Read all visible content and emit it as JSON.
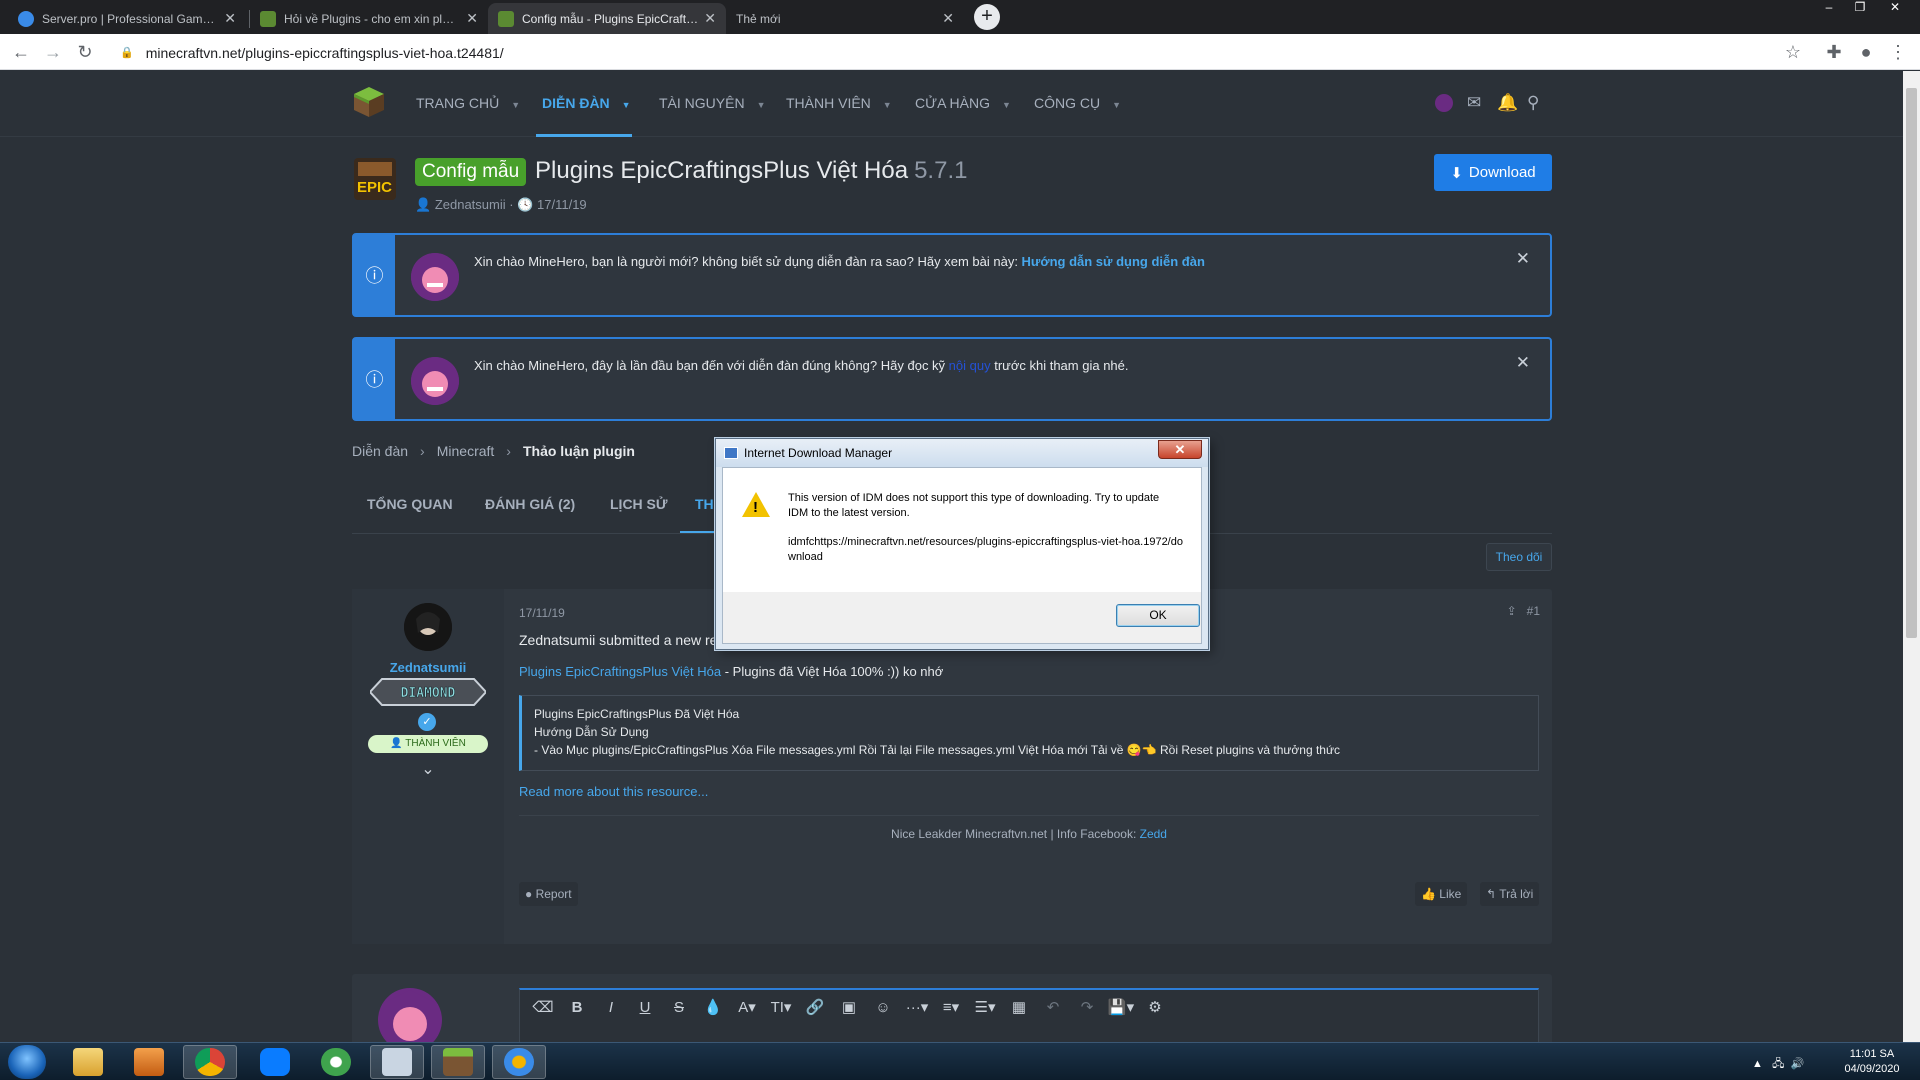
{
  "browser": {
    "tabs": [
      {
        "title": "Server.pro | Professional Game Se",
        "icon": "serverpro-icon",
        "active": false
      },
      {
        "title": "Hỏi về Plugins - cho em xin plugin",
        "icon": "minecraft-icon",
        "active": false
      },
      {
        "title": "Config mẫu - Plugins EpicCrafting",
        "icon": "minecraft-icon",
        "active": true
      },
      {
        "title": "Thẻ mới",
        "icon": "",
        "active": false
      }
    ],
    "new_tab_label": "+",
    "url": "minecraftvn.net/plugins-epiccraftingsplus-viet-hoa.t24481/",
    "window_controls": [
      "‒",
      "❐",
      "✕"
    ]
  },
  "site_nav": {
    "items": [
      {
        "label": "TRANG CHỦ",
        "active": false
      },
      {
        "label": "DIỄN ĐÀN",
        "active": true
      },
      {
        "label": "TÀI NGUYÊN",
        "active": false
      },
      {
        "label": "THÀNH VIÊN",
        "active": false
      },
      {
        "label": "CỬA HÀNG",
        "active": false
      },
      {
        "label": "CÔNG CỤ",
        "active": false
      }
    ]
  },
  "resource": {
    "prefix": "Config mẫu",
    "title": "Plugins EpicCraftingsPlus Việt Hóa",
    "version": "5.7.1",
    "author": "Zednatsumii",
    "date": "17/11/19",
    "download_label": "Download"
  },
  "notices": [
    {
      "text": "Xin chào MineHero, bạn là người mới? không biết sử dụng diễn đàn ra sao? Hãy xem bài này: ",
      "link": "Hướng dẫn sử dụng diễn đàn",
      "tail": ""
    },
    {
      "text": "Xin chào MineHero, đây là lần đầu bạn đến với diễn đàn đúng không? Hãy đọc kỹ ",
      "link": "nội quy",
      "tail": " trước khi tham gia nhé."
    }
  ],
  "breadcrumb": [
    "Diễn đàn",
    "Minecraft",
    "Thảo luận plugin"
  ],
  "page_tabs": [
    {
      "label": "TỔNG QUAN",
      "active": false
    },
    {
      "label": "ĐÁNH GIÁ (2)",
      "active": false
    },
    {
      "label": "LỊCH SỬ",
      "active": false
    },
    {
      "label": "TH",
      "active": true
    }
  ],
  "follow_label": "Theo dõi",
  "post": {
    "username": "Zednatsumii",
    "rank": "DIAMOND",
    "member_badge": "THÀNH VIÊN",
    "date": "17/11/19",
    "number": "#1",
    "intro": "Zednatsumii submitted a new re",
    "resource_link": "Plugins EpicCraftingsPlus Việt Hóa",
    "resource_desc": " - Plugins đã Việt Hóa 100% :)) ko nhớ",
    "quote_lines": [
      "Plugins EpicCraftingsPlus Đã Việt Hóa",
      "Hướng Dẫn Sử Dụng",
      "- Vào Mục plugins/EpicCraftingsPlus Xóa File messages.yml Rồi Tải lại File messages.yml Việt Hóa mới Tải về 😋👈  Rồi Reset plugins và thưởng thức"
    ],
    "read_more": "Read more about this resource...",
    "signature_text": "Nice Leakder Minecraftvn.net | Info Facebook: ",
    "signature_link": "Zedd",
    "report_label": "Report",
    "like_label": "Like",
    "reply_label": "Trả lời"
  },
  "idm_dialog": {
    "title": "Internet Download Manager",
    "message": "This version of IDM does not support this type of downloading. Try to update IDM to the latest version.",
    "url": "idmfchttps://minecraftvn.net/resources/plugins-epiccraftingsplus-viet-hoa.1972/download",
    "ok_label": "OK",
    "close_label": "✕"
  },
  "taskbar": {
    "apps": [
      "explorer-icon",
      "media-player-icon",
      "chrome-icon",
      "zalo-icon",
      "coccoc-icon",
      "keyboard-icon",
      "minecraft-icon",
      "idm-icon"
    ],
    "time": "11:01 SA",
    "date": "04/09/2020"
  }
}
